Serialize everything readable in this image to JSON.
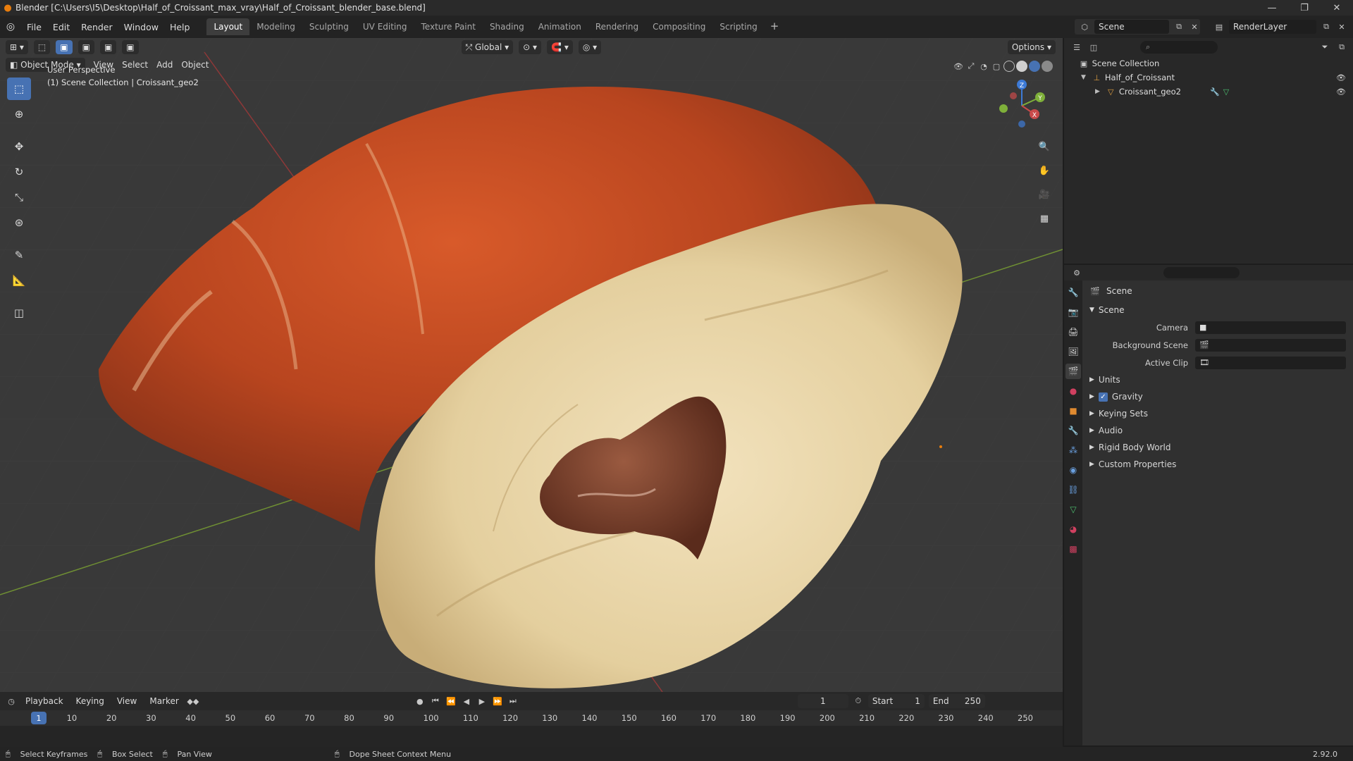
{
  "window": {
    "title": "Blender [C:\\Users\\I5\\Desktop\\Half_of_Croissant_max_vray\\Half_of_Croissant_blender_base.blend]"
  },
  "menu": [
    "File",
    "Edit",
    "Render",
    "Window",
    "Help"
  ],
  "workspaces": [
    "Layout",
    "Modeling",
    "Sculpting",
    "UV Editing",
    "Texture Paint",
    "Shading",
    "Animation",
    "Rendering",
    "Compositing",
    "Scripting"
  ],
  "active_workspace": "Layout",
  "scene_selector": {
    "scene": "Scene",
    "view_layer": "RenderLayer"
  },
  "viewport": {
    "mode": "Object Mode",
    "menus": [
      "View",
      "Select",
      "Add",
      "Object"
    ],
    "transform_orientation": "Global",
    "options_label": "Options",
    "info_line1": "User Perspective",
    "info_line2": "(1) Scene Collection | Croissant_geo2"
  },
  "outliner": {
    "root": "Scene Collection",
    "collection": "Half_of_Croissant",
    "object": "Croissant_geo2"
  },
  "properties": {
    "context_title": "Scene",
    "panel": "Scene",
    "fields": {
      "camera_label": "Camera",
      "background_label": "Background Scene",
      "active_clip_label": "Active Clip"
    },
    "subpanels": [
      "Units",
      "Gravity",
      "Keying Sets",
      "Audio",
      "Rigid Body World",
      "Custom Properties"
    ]
  },
  "timeline": {
    "menus": [
      "Playback",
      "Keying",
      "View",
      "Marker"
    ],
    "current_frame": "1",
    "start_label": "Start",
    "start": "1",
    "end_label": "End",
    "end": "250",
    "ruler": [
      "1",
      "10",
      "20",
      "30",
      "40",
      "50",
      "60",
      "70",
      "80",
      "90",
      "100",
      "110",
      "120",
      "130",
      "140",
      "150",
      "160",
      "170",
      "180",
      "190",
      "200",
      "210",
      "220",
      "230",
      "240",
      "250"
    ]
  },
  "statusbar": {
    "hints": [
      "Select Keyframes",
      "Box Select",
      "Pan View",
      "Dope Sheet Context Menu"
    ],
    "version": "2.92.0"
  },
  "colors": {
    "accent": "#4772b3",
    "blender_orange": "#e87d0d",
    "x_axis": "#c94a4a",
    "y_axis": "#7fb03a",
    "z_axis": "#3d7ad6"
  }
}
